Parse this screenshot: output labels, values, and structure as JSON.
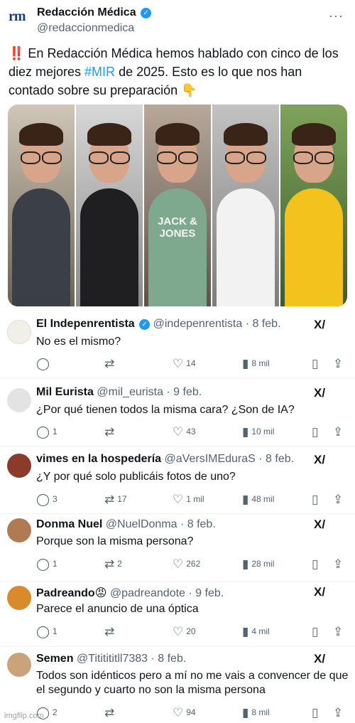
{
  "post": {
    "logo_text": "rm",
    "author_name": "Redacción Médica",
    "author_handle": "@redaccionmedica",
    "text_bangs": "‼️",
    "text_part1": " En Redacción Médica hemos hablado con cinco de los diez mejores ",
    "hashtag": "#MIR",
    "text_part2": " de 2025. Esto es lo que nos han contado sobre su preparación ",
    "text_emoji": "👇",
    "photo_text": "JACK & JONES"
  },
  "replies": [
    {
      "name": "El Indepenrentista",
      "verified": true,
      "handle": "@indepenrentista · 8 feb.",
      "text": "No es el mismo?",
      "replies": "",
      "retweets": "",
      "likes": "14",
      "views": "8 mil",
      "avatar_color": "#f2efe6"
    },
    {
      "name": "Mil Eurista",
      "verified": false,
      "handle": "@mil_eurista · 9 feb.",
      "text": "¿Por qué tienen todos la misma cara? ¿Son de IA?",
      "replies": "1",
      "retweets": "",
      "likes": "43",
      "views": "10 mil",
      "avatar_color": "#e3e3e3"
    },
    {
      "name": "vimes en la hospedería",
      "verified": false,
      "handle": "@aVersIMEduraS · 8 feb.",
      "text": "¿Y por qué solo publicáis fotos de uno?",
      "replies": "3",
      "retweets": "17",
      "likes": "1 mil",
      "views": "48 mil",
      "avatar_color": "#8a3b2a"
    },
    {
      "name": "Donma Nuel",
      "verified": false,
      "handle": "@NuelDonma · 8 feb.",
      "text": "Porque son la misma persona?",
      "replies": "1",
      "retweets": "2",
      "likes": "262",
      "views": "28 mil",
      "avatar_color": "#b07a52"
    },
    {
      "name": "Padreando",
      "verified": false,
      "handle": "@padreandote · 9 feb.",
      "text": "Parece el anuncio de una óptica",
      "replies": "1",
      "retweets": "",
      "likes": "20",
      "views": "4 mil",
      "avatar_color": "#d98a2b"
    },
    {
      "name": "Semen",
      "verified": false,
      "handle": "@Tititititll7383 · 8 feb.",
      "text": "Todos son idénticos pero a mí no me vais a convencer de que el segundo y cuarto no son la misma persona",
      "replies": "2",
      "retweets": "",
      "likes": "94",
      "views": "8 mil",
      "avatar_color": "#c9a47a"
    }
  ],
  "icons": {
    "more": "···",
    "verified": "✓",
    "grok": "X/",
    "reply": "◯",
    "retweet": "⇄",
    "like": "♡",
    "views": "▮",
    "bookmark": "▯",
    "share": "⇪"
  },
  "padreando_emoji": "😡",
  "watermark": "imgflip.com",
  "colors": {
    "accent": "#1d9bf0",
    "muted": "#536471",
    "text": "#0f1419"
  }
}
